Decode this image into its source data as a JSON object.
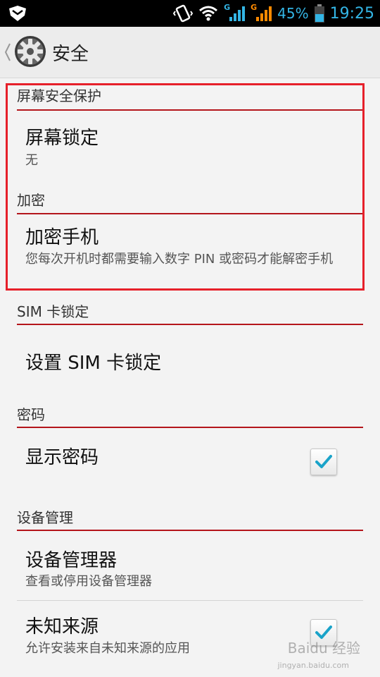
{
  "status_bar": {
    "network_label_1": "G",
    "network_label_2": "G",
    "battery": "45%",
    "time": "19:25"
  },
  "action_bar": {
    "title": "安全"
  },
  "sections": {
    "screen_security": {
      "header": "屏幕安全保护",
      "screen_lock": {
        "title": "屏幕锁定",
        "subtitle": "无"
      }
    },
    "encryption": {
      "header": "加密",
      "encrypt_phone": {
        "title": "加密手机",
        "subtitle": "您每次开机时都需要输入数字 PIN 或密码才能解密手机"
      }
    },
    "sim_lock": {
      "header": "SIM 卡锁定",
      "setup": {
        "title": "设置 SIM 卡锁定"
      }
    },
    "passwords": {
      "header": "密码",
      "show_password": {
        "title": "显示密码",
        "checked": true
      }
    },
    "device_admin": {
      "header": "设备管理",
      "device_admins": {
        "title": "设备管理器",
        "subtitle": "查看或停用设备管理器"
      },
      "unknown_sources": {
        "title": "未知来源",
        "subtitle": "允许安装来自未知来源的应用",
        "checked": true
      }
    }
  },
  "watermark": {
    "text": "Baidu 经验",
    "sub": "jingyan.baidu.com"
  },
  "colors": {
    "accent": "#33b5e5",
    "header_line": "#b4151b",
    "highlight_box": "#e6202a"
  }
}
